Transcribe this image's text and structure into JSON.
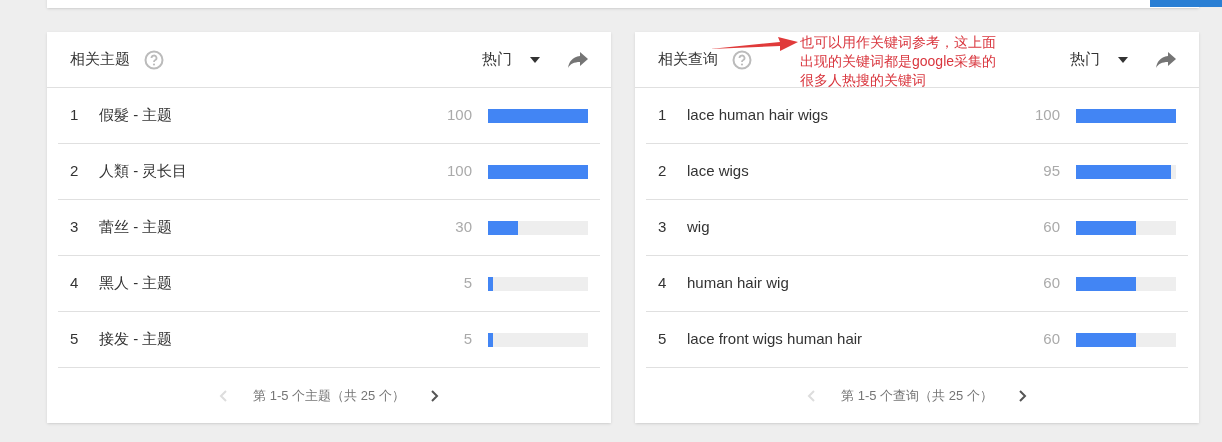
{
  "cards": [
    {
      "title": "相关主题",
      "sort": "热门",
      "rows": [
        {
          "rank": "1",
          "label": "假髮 - 主题",
          "value": "100",
          "level": 1
        },
        {
          "rank": "2",
          "label": "人類 - 灵长目",
          "value": "100",
          "level": 1
        },
        {
          "rank": "3",
          "label": "蕾丝 - 主题",
          "value": "30",
          "level": 0.3
        },
        {
          "rank": "4",
          "label": "黑人 - 主题",
          "value": "5",
          "level": 0.05
        },
        {
          "rank": "5",
          "label": "接发 - 主题",
          "value": "5",
          "level": 0.05
        }
      ],
      "pagination": {
        "text": "第 1-5 个主题（共 25 个）",
        "prev_disabled": true,
        "next_disabled": false
      }
    },
    {
      "title": "相关查询",
      "sort": "热门",
      "rows": [
        {
          "rank": "1",
          "label": "lace human hair wigs",
          "value": "100",
          "level": 1
        },
        {
          "rank": "2",
          "label": "lace wigs",
          "value": "95",
          "level": 0.95
        },
        {
          "rank": "3",
          "label": "wig",
          "value": "60",
          "level": 0.6
        },
        {
          "rank": "4",
          "label": "human hair wig",
          "value": "60",
          "level": 0.6
        },
        {
          "rank": "5",
          "label": "lace front wigs human hair",
          "value": "60",
          "level": 0.6
        }
      ],
      "pagination": {
        "text": "第 1-5 个查询（共 25 个）",
        "prev_disabled": true,
        "next_disabled": false
      }
    }
  ],
  "annotation": {
    "lines": [
      "也可以用作关键词参考，这上面",
      "出现的关键词都是google采集的",
      "很多人热搜的关键词"
    ]
  }
}
